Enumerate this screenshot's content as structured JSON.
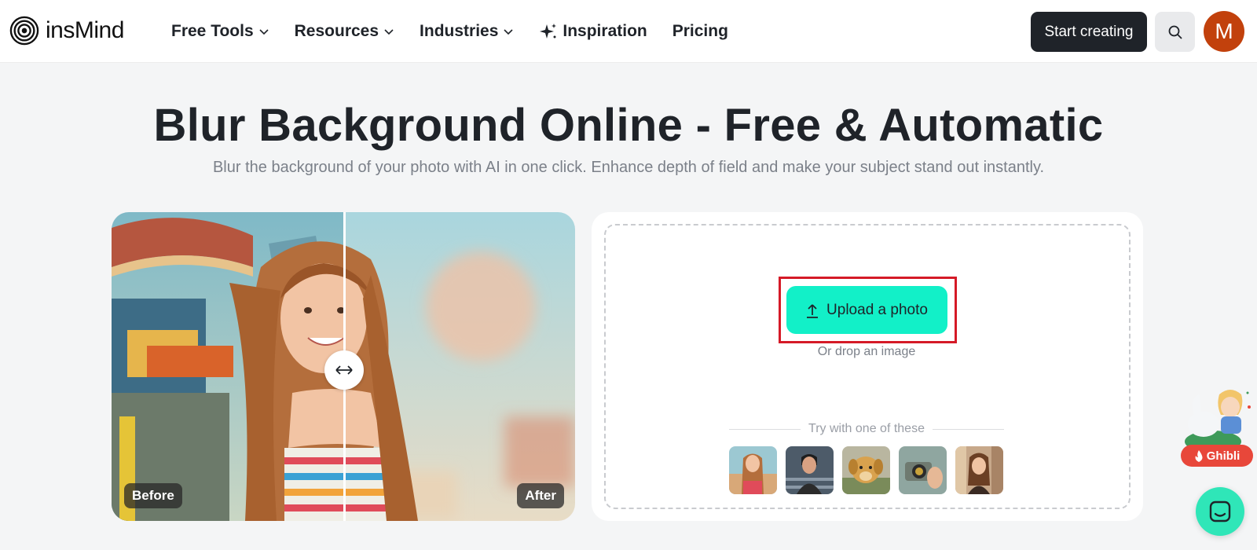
{
  "brand": {
    "name": "insMind",
    "logo_icon": "concentric-circles-logo"
  },
  "nav": {
    "items": [
      {
        "label": "Free Tools",
        "has_dropdown": true
      },
      {
        "label": "Resources",
        "has_dropdown": true
      },
      {
        "label": "Industries",
        "has_dropdown": true
      },
      {
        "label": "Inspiration",
        "icon": "sparkle-icon"
      },
      {
        "label": "Pricing"
      }
    ]
  },
  "header_actions": {
    "start_label": "Start creating",
    "search_icon": "search-icon",
    "avatar_initial": "M",
    "avatar_color": "#c2410c"
  },
  "hero": {
    "title": "Blur Background Online - Free & Automatic",
    "subtitle": "Blur the background of your photo with AI in one click. Enhance depth of field and make your subject stand out instantly."
  },
  "preview": {
    "before_label": "Before",
    "after_label": "After",
    "slider_icon": "left-right-arrow-icon"
  },
  "upload": {
    "button_label": "Upload a photo",
    "button_icon": "upload-arrow-icon",
    "button_color": "#12f0c8",
    "drop_hint": "Or drop an image",
    "try_label": "Try with one of these",
    "samples": [
      "sample-girl-carousel",
      "sample-man-stairs",
      "sample-golden-dog",
      "sample-hand-camera",
      "sample-woman-store"
    ]
  },
  "widgets": {
    "ghibli_label": "Ghibli",
    "ghibli_icon": "fire-icon",
    "chat_icon": "chat-icon"
  },
  "colors": {
    "highlight": "#d51a27",
    "dark_button": "#1f2329"
  }
}
